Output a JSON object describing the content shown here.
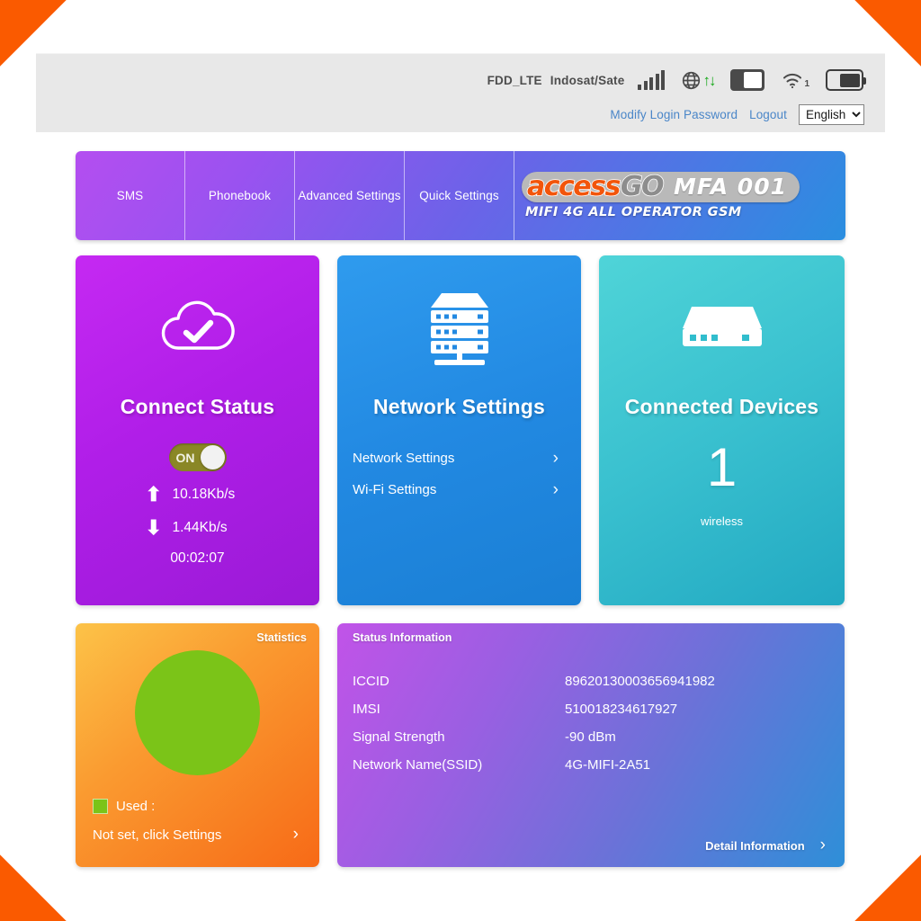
{
  "statusbar": {
    "network_mode": "FDD_LTE",
    "carrier": "Indosat/Sate",
    "icons": [
      "signal-bars-icon",
      "globe-icon",
      "data-transfer-icon",
      "sim-card-icon",
      "wifi-icon",
      "battery-icon"
    ],
    "wifi_clients": "1"
  },
  "account": {
    "modify_password": "Modify Login Password",
    "logout": "Logout",
    "language": "English",
    "language_options": [
      "English"
    ]
  },
  "nav": {
    "tabs": [
      {
        "label": "SMS"
      },
      {
        "label": "Phonebook"
      },
      {
        "label": "Advanced Settings"
      },
      {
        "label": "Quick Settings"
      }
    ]
  },
  "brand": {
    "name_part1": "access",
    "name_part2": "GO",
    "model": "MFA 001",
    "tagline": "MIFI 4G ALL OPERATOR GSM"
  },
  "connect_status": {
    "title": "Connect Status",
    "icon": "cloud-check-icon",
    "toggle_label": "ON",
    "toggle_state": "on",
    "upload_speed": "10.18Kb/s",
    "download_speed": "1.44Kb/s",
    "uptime": "00:02:07"
  },
  "network_settings": {
    "title": "Network Settings",
    "icon": "server-rack-icon",
    "links": [
      {
        "label": "Network Settings"
      },
      {
        "label": "Wi-Fi Settings"
      }
    ]
  },
  "connected_devices": {
    "title": "Connected Devices",
    "icon": "router-icon",
    "count": "1",
    "label": "wireless"
  },
  "statistics": {
    "title": "Statistics",
    "legend_label": "Used  :",
    "legend_color": "#7bc418",
    "footer": "Not set, click Settings"
  },
  "status_information": {
    "title": "Status Information",
    "rows": [
      {
        "label": "ICCID",
        "value": "89620130003656941982"
      },
      {
        "label": "IMSI",
        "value": "510018234617927"
      },
      {
        "label": "Signal Strength",
        "value": "-90 dBm"
      },
      {
        "label": "Network Name(SSID)",
        "value": "4G-MIFI-2A51"
      }
    ],
    "detail_link": "Detail Information"
  }
}
